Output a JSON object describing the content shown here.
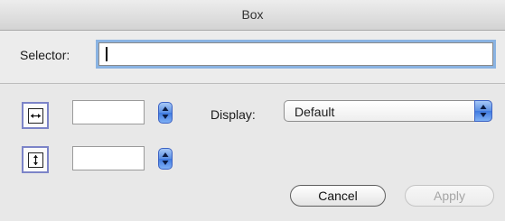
{
  "window": {
    "title": "Box"
  },
  "selector": {
    "label": "Selector:",
    "value": ""
  },
  "width_row": {
    "icon": "horizontal-resize-icon",
    "value": ""
  },
  "height_row": {
    "icon": "vertical-resize-icon",
    "value": ""
  },
  "display": {
    "label": "Display:",
    "selected": "Default"
  },
  "buttons": {
    "cancel": "Cancel",
    "apply": "Apply"
  },
  "colors": {
    "focus_ring": "#8ab3e2",
    "aqua_blue": "#3f79e0",
    "icon_border": "#7c84c8"
  }
}
